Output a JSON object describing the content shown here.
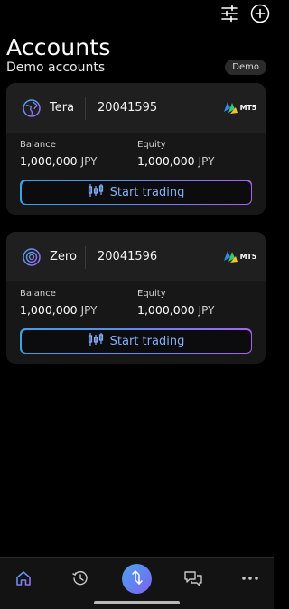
{
  "header": {
    "title": "Accounts",
    "subtitle": "Demo accounts",
    "badge": "Demo"
  },
  "top_icons": [
    "sliders-icon",
    "plus-icon"
  ],
  "accounts": [
    {
      "type": "Tera",
      "number": "20041595",
      "platform": "MT5",
      "balance_label": "Balance",
      "balance_value": "1,000,000",
      "balance_currency": "JPY",
      "equity_label": "Equity",
      "equity_value": "1,000,000",
      "equity_currency": "JPY",
      "button_label": "Start trading",
      "icon": "globe-icon"
    },
    {
      "type": "Zero",
      "number": "20041596",
      "platform": "MT5",
      "balance_label": "Balance",
      "balance_value": "1,000,000",
      "balance_currency": "JPY",
      "equity_label": "Equity",
      "equity_value": "1,000,000",
      "equity_currency": "JPY",
      "button_label": "Start trading",
      "icon": "target-icon"
    }
  ],
  "bottom_nav": {
    "items": [
      "home-icon",
      "history-icon",
      "transfer-icon",
      "chat-icon",
      "more-icon"
    ],
    "accent": "#7c63f0"
  },
  "colors": {
    "background": "#000000",
    "card": "#171717",
    "button_gradient_start": "#3aa3e8",
    "button_gradient_end": "#a860f2",
    "button_text": "#86aef7"
  }
}
